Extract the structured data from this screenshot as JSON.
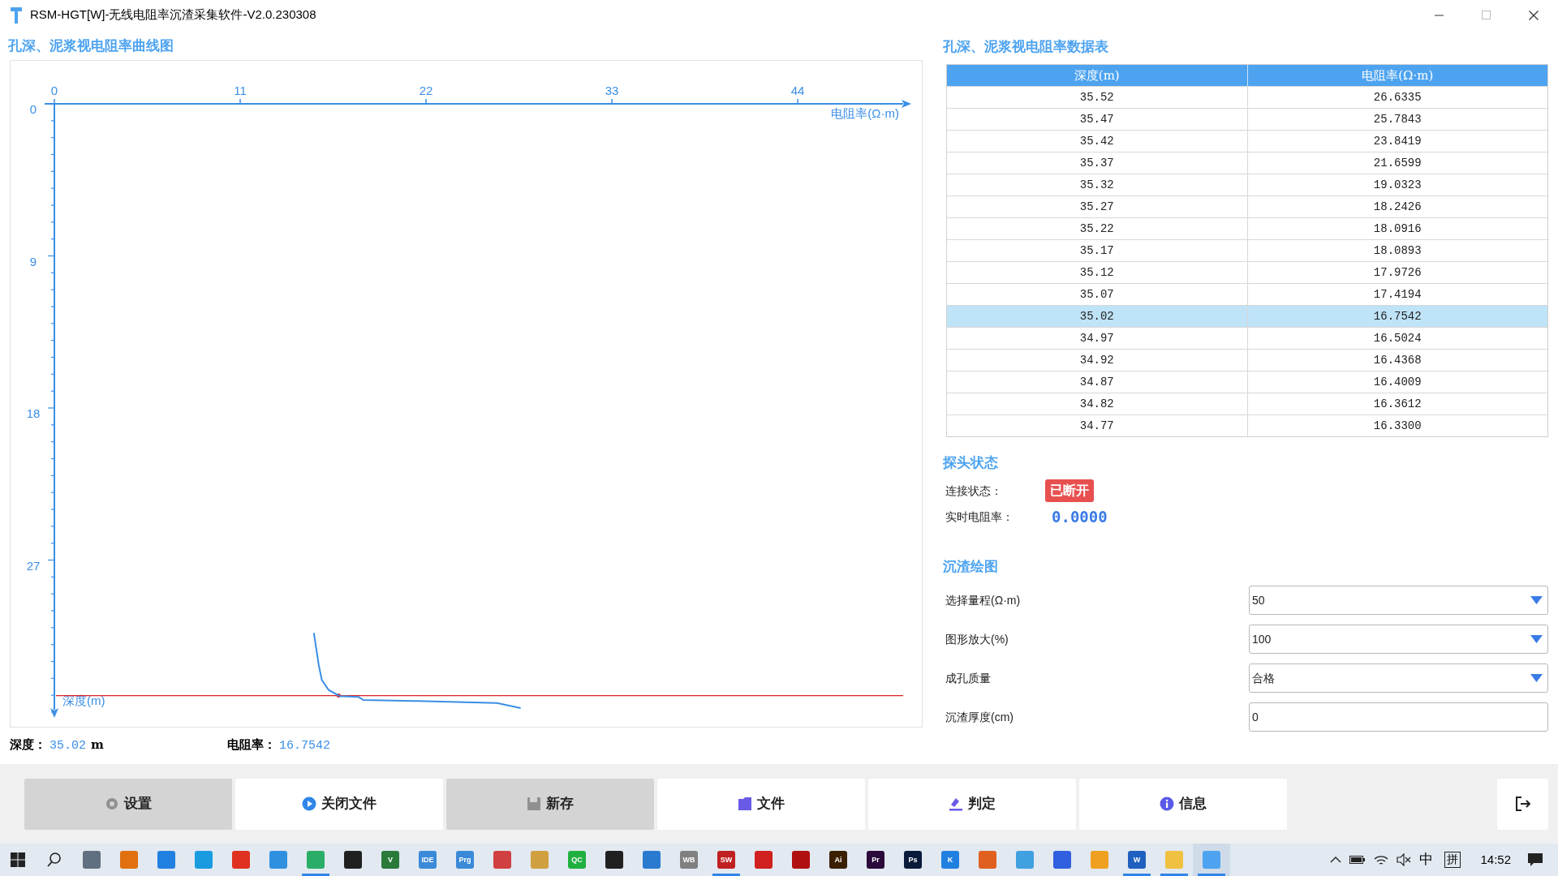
{
  "window": {
    "title": "RSM-HGT[W]-无线电阻率沉渣采集软件-V2.0.230308"
  },
  "chart_panel": {
    "title": "孔深、泥浆视电阻率曲线图",
    "chart_data": {
      "type": "line",
      "xlabel": "电阻率(Ω·m)",
      "ylabel": "深度(m)",
      "x": [
        15.36,
        15.65,
        15.83,
        16.24,
        16.88,
        18.0,
        18.3,
        21.5,
        26.2,
        27.6
      ],
      "series": [
        {
          "color": "#3a8ee6",
          "values": [
            31.31,
            33.21,
            34.1,
            34.69,
            35.05,
            35.1,
            35.28,
            35.34,
            35.46,
            35.76
          ]
        }
      ],
      "xlim": [
        0,
        50
      ],
      "ylim": [
        36,
        0
      ],
      "xticks": [
        0,
        11,
        22,
        33,
        44
      ],
      "yticks": [
        0,
        9,
        18,
        27
      ],
      "ref_lines": [
        {
          "axis": "y",
          "value": 35.02
        }
      ]
    }
  },
  "readout": [
    {
      "label": "深度：",
      "value": "35.02",
      "unit": "m"
    },
    {
      "label": "电阻率：",
      "value": "16.7542"
    }
  ],
  "table_panel": {
    "title": "孔深、泥浆视电阻率数据表",
    "columns": [
      "深度(m)",
      "电阻率(Ω·m)"
    ],
    "rows": [
      {
        "cells": [
          "35.52",
          "26.6335"
        ],
        "selected": false
      },
      {
        "cells": [
          "35.47",
          "25.7843"
        ],
        "selected": false
      },
      {
        "cells": [
          "35.42",
          "23.8419"
        ],
        "selected": false
      },
      {
        "cells": [
          "35.37",
          "21.6599"
        ],
        "selected": false
      },
      {
        "cells": [
          "35.32",
          "19.0323"
        ],
        "selected": false
      },
      {
        "cells": [
          "35.27",
          "18.2426"
        ],
        "selected": false
      },
      {
        "cells": [
          "35.22",
          "18.0916"
        ],
        "selected": false
      },
      {
        "cells": [
          "35.17",
          "18.0893"
        ],
        "selected": false
      },
      {
        "cells": [
          "35.12",
          "17.9726"
        ],
        "selected": false
      },
      {
        "cells": [
          "35.07",
          "17.4194"
        ],
        "selected": false
      },
      {
        "cells": [
          "35.02",
          "16.7542"
        ],
        "selected": true
      },
      {
        "cells": [
          "34.97",
          "16.5024"
        ],
        "selected": false
      },
      {
        "cells": [
          "34.92",
          "16.4368"
        ],
        "selected": false
      },
      {
        "cells": [
          "34.87",
          "16.4009"
        ],
        "selected": false
      },
      {
        "cells": [
          "34.82",
          "16.3612"
        ],
        "selected": false
      },
      {
        "cells": [
          "34.77",
          "16.3300"
        ],
        "selected": false
      }
    ]
  },
  "probe_status": {
    "title": "探头状态",
    "connection": {
      "label": "连接状态：",
      "value": "已断开",
      "connected": false
    },
    "resistivity": {
      "label": "实时电阻率：",
      "value": "0.0000"
    }
  },
  "slag_plot": {
    "title": "沉渣绘图",
    "fields": [
      {
        "label": "选择量程(Ω·m)",
        "value": "50",
        "kind": "dropdown"
      },
      {
        "label": "图形放大(%)",
        "value": "100",
        "kind": "dropdown"
      },
      {
        "label": "成孔质量",
        "value": "合格",
        "kind": "dropdown"
      },
      {
        "label": "沉渣厚度(cm)",
        "value": "0",
        "kind": "input"
      }
    ]
  },
  "toolbar": {
    "buttons": [
      {
        "label": "设置",
        "disabled": true
      },
      {
        "label": "关闭文件",
        "disabled": false
      },
      {
        "label": "新存",
        "disabled": true
      },
      {
        "label": "文件",
        "disabled": false
      },
      {
        "label": "判定",
        "disabled": false
      },
      {
        "label": "信息",
        "disabled": false
      }
    ]
  },
  "taskbar": {
    "apps": [
      {
        "color": "#607080",
        "active": false
      },
      {
        "color": "#e07010",
        "active": false
      },
      {
        "color": "#2080e0",
        "active": false
      },
      {
        "color": "#1a9be0",
        "active": false
      },
      {
        "color": "#e03020",
        "active": false
      },
      {
        "color": "#3090e0",
        "active": false
      },
      {
        "color": "#2aae67",
        "active": true
      },
      {
        "color": "#202020",
        "active": false
      },
      {
        "color": "#2a7a3a",
        "label": "V",
        "active": false
      },
      {
        "color": "#3a8ad8",
        "label": "IDE",
        "active": false
      },
      {
        "color": "#3a8ad8",
        "label": "Prg",
        "active": false
      },
      {
        "color": "#d04040",
        "active": false
      },
      {
        "color": "#d0a040",
        "active": false
      },
      {
        "color": "#20b040",
        "label": "QC",
        "active": false
      },
      {
        "color": "#202020",
        "active": false
      },
      {
        "color": "#2a7ad0",
        "active": false
      },
      {
        "color": "#808080",
        "label": "WB",
        "active": false
      },
      {
        "color": "#c02020",
        "label": "SW",
        "active": true
      },
      {
        "color": "#d02020",
        "active": false
      },
      {
        "color": "#b01010",
        "active": false
      },
      {
        "color": "#3a2000",
        "label": "Ai",
        "active": false
      },
      {
        "color": "#2a0a3a",
        "label": "Pr",
        "active": false
      },
      {
        "color": "#0a1a3a",
        "label": "Ps",
        "active": false
      },
      {
        "color": "#2080e0",
        "label": "K",
        "active": false
      },
      {
        "color": "#e06020",
        "active": false
      },
      {
        "color": "#40a0e0",
        "active": false
      },
      {
        "color": "#3060e0",
        "active": false
      },
      {
        "color": "#f0a020",
        "active": false
      },
      {
        "color": "#2060c0",
        "label": "W",
        "active": true
      },
      {
        "color": "#f0c040",
        "active": true
      },
      {
        "color": "#4da3f0",
        "active": true
      }
    ],
    "tray": {
      "ime_mode": "中",
      "ime": "拼",
      "time": "14:52"
    }
  }
}
